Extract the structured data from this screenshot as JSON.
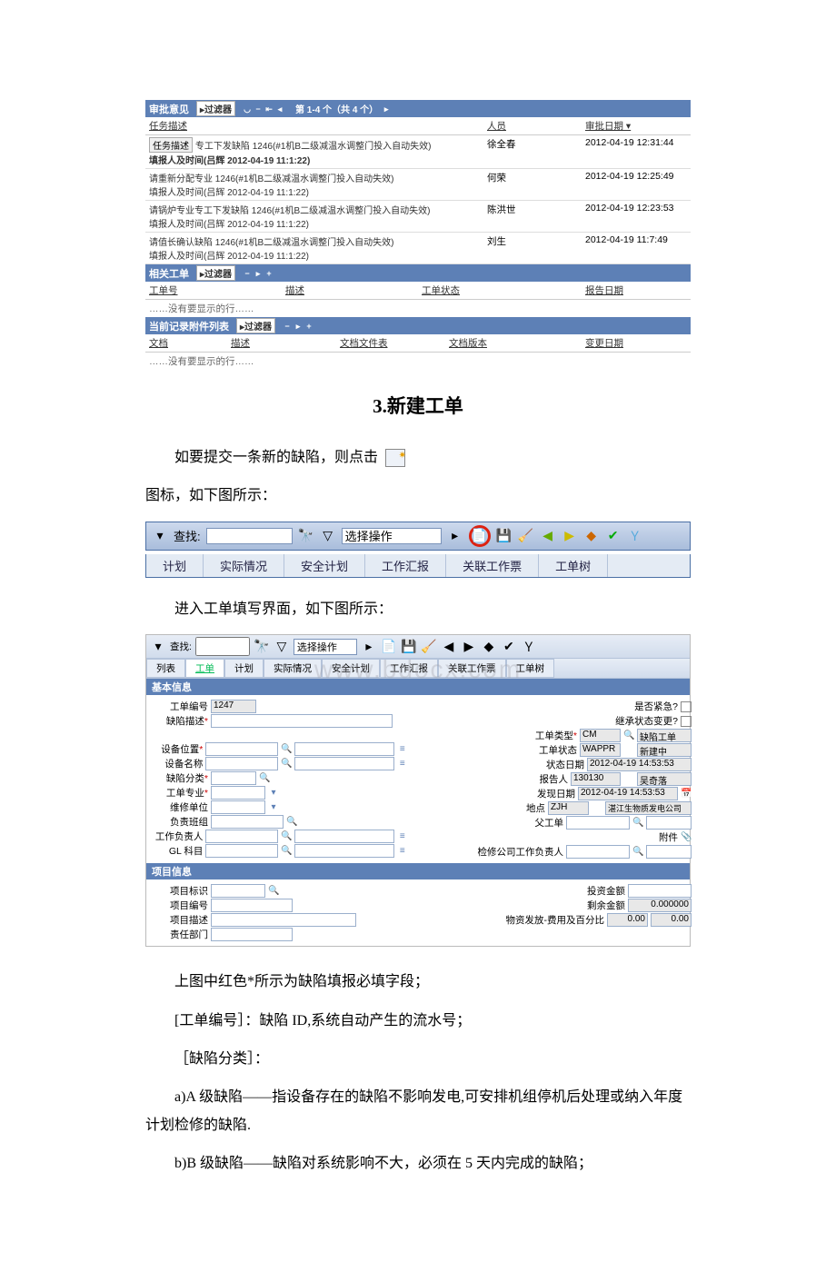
{
  "approval": {
    "title": "审批意见",
    "filter": "过滤器",
    "pagination": "第 1-4 个（共 4 个）",
    "cols": {
      "task": "任务描述",
      "person": "人员",
      "date": "审批日期"
    },
    "task_btn": "任务描述",
    "rows": [
      {
        "main": "专工下发缺陷 1246(#1机B二级减温水调整门投入自动失效)",
        "sub": "填报人及时间(吕辉 2012-04-19 11:1:22)",
        "person": "徐全春",
        "date": "2012-04-19 12:31:44"
      },
      {
        "main": "请重新分配专业 1246(#1机B二级减温水调整门投入自动失效)",
        "sub": "填报人及时间(吕辉 2012-04-19 11:1:22)",
        "person": "何荣",
        "date": "2012-04-19 12:25:49"
      },
      {
        "main": "请锅炉专业专工下发缺陷 1246(#1机B二级减温水调整门投入自动失效)",
        "sub": "填报人及时间(吕辉 2012-04-19 11:1:22)",
        "person": "陈洪世",
        "date": "2012-04-19 12:23:53"
      },
      {
        "main": "请值长确认缺陷 1246(#1机B二级减温水调整门投入自动失效)",
        "sub": "填报人及时间(吕辉 2012-04-19 11:1:22)",
        "person": "刘生",
        "date": "2012-04-19 11:7:49"
      }
    ]
  },
  "related_wo": {
    "title": "相关工单",
    "filter": "过滤器",
    "cols": {
      "no": "工单号",
      "desc": "描述",
      "status": "工单状态",
      "date": "报告日期"
    },
    "empty": "……没有要显示的行……"
  },
  "attachments": {
    "title": "当前记录附件列表",
    "filter": "过滤器",
    "cols": {
      "doc": "文档",
      "desc": "描述",
      "filelist": "文档文件表",
      "version": "文档版本",
      "chgdate": "变更日期"
    },
    "empty": "……没有要显示的行……"
  },
  "doc": {
    "heading": "3.新建工单",
    "p1a": "如要提交一条新的缺陷，则点击",
    "p2": "图标，如下图所示：",
    "p3": "进入工单填写界面，如下图所示：",
    "p4": "上图中红色*所示为缺陷填报必填字段；",
    "p5": "[工单编号］：缺陷 ID,系统自动产生的流水号；",
    "p6": "［缺陷分类］：",
    "p7": "a)A 级缺陷——指设备存在的缺陷不影响发电,可安排机组停机后处理或纳入年度计划检修的缺陷.",
    "p8": "b)B 级缺陷——缺陷对系统影响不大，必须在 5 天内完成的缺陷；"
  },
  "toolbar": {
    "search": "查找:",
    "action": "选择操作",
    "tabs": [
      "计划",
      "实际情况",
      "安全计划",
      "工作汇报",
      "关联工作票",
      "工单树"
    ]
  },
  "form": {
    "toolbar_search": "查找:",
    "toolbar_action": "选择操作",
    "tabs": [
      "列表",
      "工单",
      "计划",
      "实际情况",
      "安全计划",
      "工作汇报",
      "关联工作票",
      "工单树"
    ],
    "section_basic": "基本信息",
    "section_project": "项目信息",
    "fields": {
      "wo_no": "工单编号",
      "wo_no_val": "1247",
      "defect_desc": "缺陷描述",
      "eq_loc": "设备位置",
      "eq_name": "设备名称",
      "defect_cls": "缺陷分类",
      "wo_spec": "工单专业",
      "maint_unit": "维修单位",
      "resp_team": "负责班组",
      "work_resp": "工作负责人",
      "gl_acct": "GL 科目",
      "urgent": "是否紧急?",
      "inherit": "继承状态变更?",
      "wo_type": "工单类型",
      "wo_type_val": "CM",
      "wo_type_desc": "缺陷工单",
      "wo_status": "工单状态",
      "wo_status_val": "WAPPR",
      "wo_status_desc": "新建中",
      "status_date": "状态日期",
      "status_date_val": "2012-04-19 14:53:53",
      "reporter": "报告人",
      "reporter_val": "130130",
      "reporter_desc": "吴奇落",
      "find_date": "发现日期",
      "find_date_val": "2012-04-19 14:53:53",
      "site": "地点",
      "site_val": "ZJH",
      "site_desc": "湛江生物质发电公司",
      "parent_wo": "父工单",
      "attachment": "附件",
      "insp_resp": "检修公司工作负责人",
      "proj_mark": "项目标识",
      "proj_no": "项目编号",
      "proj_desc": "项目描述",
      "resp_dept": "责任部门",
      "inv_amt": "投资金额",
      "rem_amt": "剩余金额",
      "rem_amt_val": "0.000000",
      "mat_cost": "物资发放-费用及百分比",
      "mat_cost_v1": "0.00",
      "mat_cost_v2": "0.00"
    }
  },
  "watermark": "www.bdocx.com"
}
